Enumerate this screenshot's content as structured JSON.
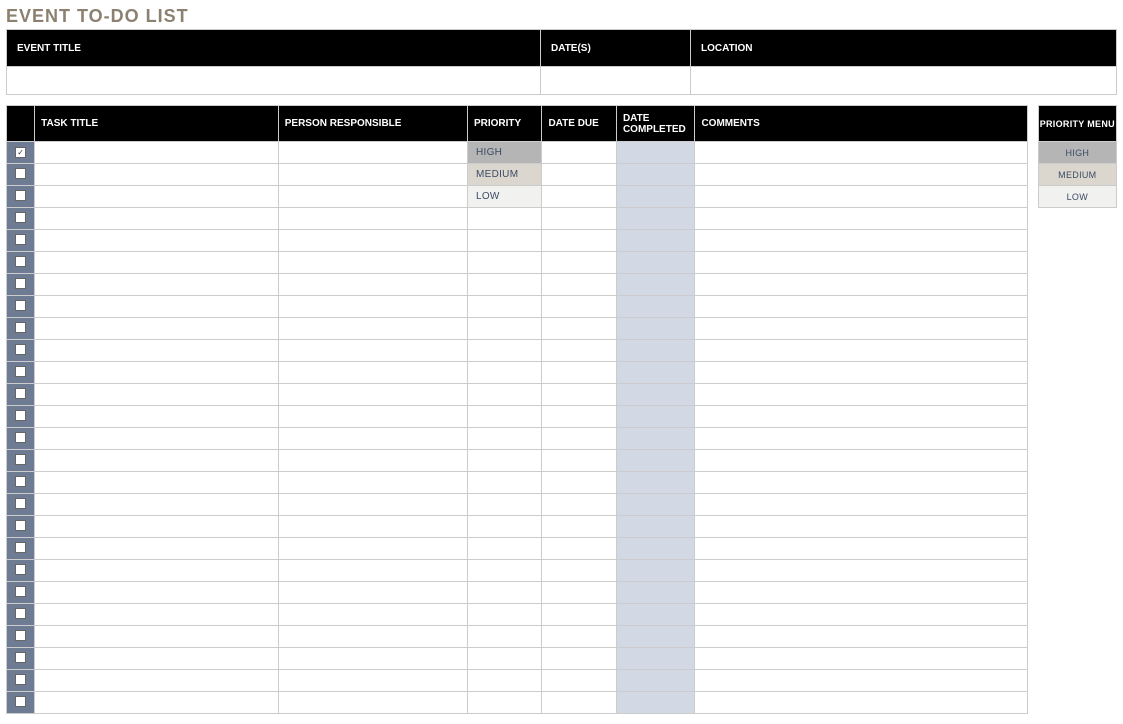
{
  "title": "EVENT TO-DO LIST",
  "header": {
    "event_title_label": "EVENT TITLE",
    "dates_label": "DATE(S)",
    "location_label": "LOCATION",
    "event_title_value": "",
    "dates_value": "",
    "location_value": ""
  },
  "columns": {
    "task_title": "TASK TITLE",
    "person_responsible": "PERSON RESPONSIBLE",
    "priority": "PRIORITY",
    "date_due": "DATE DUE",
    "date_completed": "DATE COMPLETED",
    "comments": "COMMENTS"
  },
  "priority_menu": {
    "header": "PRIORITY MENU",
    "high": "HIGH",
    "medium": "MEDIUM",
    "low": "LOW"
  },
  "rows": [
    {
      "checked": true,
      "task": "",
      "person": "",
      "priority": "HIGH",
      "priority_class": "pri-high",
      "due": "",
      "completed": "",
      "comments": ""
    },
    {
      "checked": false,
      "task": "",
      "person": "",
      "priority": "MEDIUM",
      "priority_class": "pri-medium",
      "due": "",
      "completed": "",
      "comments": ""
    },
    {
      "checked": false,
      "task": "",
      "person": "",
      "priority": "LOW",
      "priority_class": "pri-low",
      "due": "",
      "completed": "",
      "comments": ""
    },
    {
      "checked": false,
      "task": "",
      "person": "",
      "priority": "",
      "priority_class": "",
      "due": "",
      "completed": "",
      "comments": ""
    },
    {
      "checked": false,
      "task": "",
      "person": "",
      "priority": "",
      "priority_class": "",
      "due": "",
      "completed": "",
      "comments": ""
    },
    {
      "checked": false,
      "task": "",
      "person": "",
      "priority": "",
      "priority_class": "",
      "due": "",
      "completed": "",
      "comments": ""
    },
    {
      "checked": false,
      "task": "",
      "person": "",
      "priority": "",
      "priority_class": "",
      "due": "",
      "completed": "",
      "comments": ""
    },
    {
      "checked": false,
      "task": "",
      "person": "",
      "priority": "",
      "priority_class": "",
      "due": "",
      "completed": "",
      "comments": ""
    },
    {
      "checked": false,
      "task": "",
      "person": "",
      "priority": "",
      "priority_class": "",
      "due": "",
      "completed": "",
      "comments": ""
    },
    {
      "checked": false,
      "task": "",
      "person": "",
      "priority": "",
      "priority_class": "",
      "due": "",
      "completed": "",
      "comments": ""
    },
    {
      "checked": false,
      "task": "",
      "person": "",
      "priority": "",
      "priority_class": "",
      "due": "",
      "completed": "",
      "comments": ""
    },
    {
      "checked": false,
      "task": "",
      "person": "",
      "priority": "",
      "priority_class": "",
      "due": "",
      "completed": "",
      "comments": ""
    },
    {
      "checked": false,
      "task": "",
      "person": "",
      "priority": "",
      "priority_class": "",
      "due": "",
      "completed": "",
      "comments": ""
    },
    {
      "checked": false,
      "task": "",
      "person": "",
      "priority": "",
      "priority_class": "",
      "due": "",
      "completed": "",
      "comments": ""
    },
    {
      "checked": false,
      "task": "",
      "person": "",
      "priority": "",
      "priority_class": "",
      "due": "",
      "completed": "",
      "comments": ""
    },
    {
      "checked": false,
      "task": "",
      "person": "",
      "priority": "",
      "priority_class": "",
      "due": "",
      "completed": "",
      "comments": ""
    },
    {
      "checked": false,
      "task": "",
      "person": "",
      "priority": "",
      "priority_class": "",
      "due": "",
      "completed": "",
      "comments": ""
    },
    {
      "checked": false,
      "task": "",
      "person": "",
      "priority": "",
      "priority_class": "",
      "due": "",
      "completed": "",
      "comments": ""
    },
    {
      "checked": false,
      "task": "",
      "person": "",
      "priority": "",
      "priority_class": "",
      "due": "",
      "completed": "",
      "comments": ""
    },
    {
      "checked": false,
      "task": "",
      "person": "",
      "priority": "",
      "priority_class": "",
      "due": "",
      "completed": "",
      "comments": ""
    },
    {
      "checked": false,
      "task": "",
      "person": "",
      "priority": "",
      "priority_class": "",
      "due": "",
      "completed": "",
      "comments": ""
    },
    {
      "checked": false,
      "task": "",
      "person": "",
      "priority": "",
      "priority_class": "",
      "due": "",
      "completed": "",
      "comments": ""
    },
    {
      "checked": false,
      "task": "",
      "person": "",
      "priority": "",
      "priority_class": "",
      "due": "",
      "completed": "",
      "comments": ""
    },
    {
      "checked": false,
      "task": "",
      "person": "",
      "priority": "",
      "priority_class": "",
      "due": "",
      "completed": "",
      "comments": ""
    },
    {
      "checked": false,
      "task": "",
      "person": "",
      "priority": "",
      "priority_class": "",
      "due": "",
      "completed": "",
      "comments": ""
    },
    {
      "checked": false,
      "task": "",
      "person": "",
      "priority": "",
      "priority_class": "",
      "due": "",
      "completed": "",
      "comments": ""
    }
  ]
}
